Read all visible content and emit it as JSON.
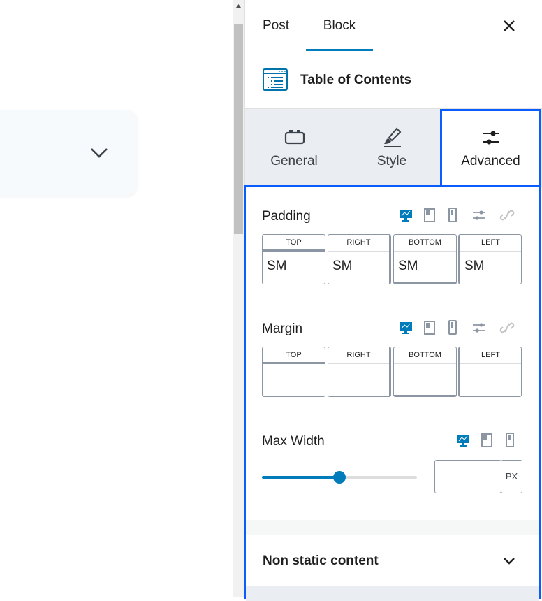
{
  "sidebar": {
    "tabs": {
      "post": "Post",
      "block": "Block"
    },
    "block_title": "Table of Contents",
    "panel_tabs": {
      "general": "General",
      "style": "Style",
      "advanced": "Advanced"
    },
    "padding": {
      "label": "Padding",
      "sides": {
        "top": "TOP",
        "right": "RIGHT",
        "bottom": "BOTTOM",
        "left": "LEFT"
      },
      "values": {
        "top": "SM",
        "right": "SM",
        "bottom": "SM",
        "left": "SM"
      }
    },
    "margin": {
      "label": "Margin",
      "sides": {
        "top": "TOP",
        "right": "RIGHT",
        "bottom": "BOTTOM",
        "left": "LEFT"
      },
      "values": {
        "top": "",
        "right": "",
        "bottom": "",
        "left": ""
      }
    },
    "max_width": {
      "label": "Max Width",
      "unit": "PX",
      "value": "",
      "slider_fraction": 0.5
    },
    "non_static_content": "Non static content"
  },
  "icons": {
    "device_active": "desktop-icon",
    "colors": {
      "accent": "#007cba",
      "highlight": "#0a5cff",
      "muted": "#8c96a3"
    }
  }
}
